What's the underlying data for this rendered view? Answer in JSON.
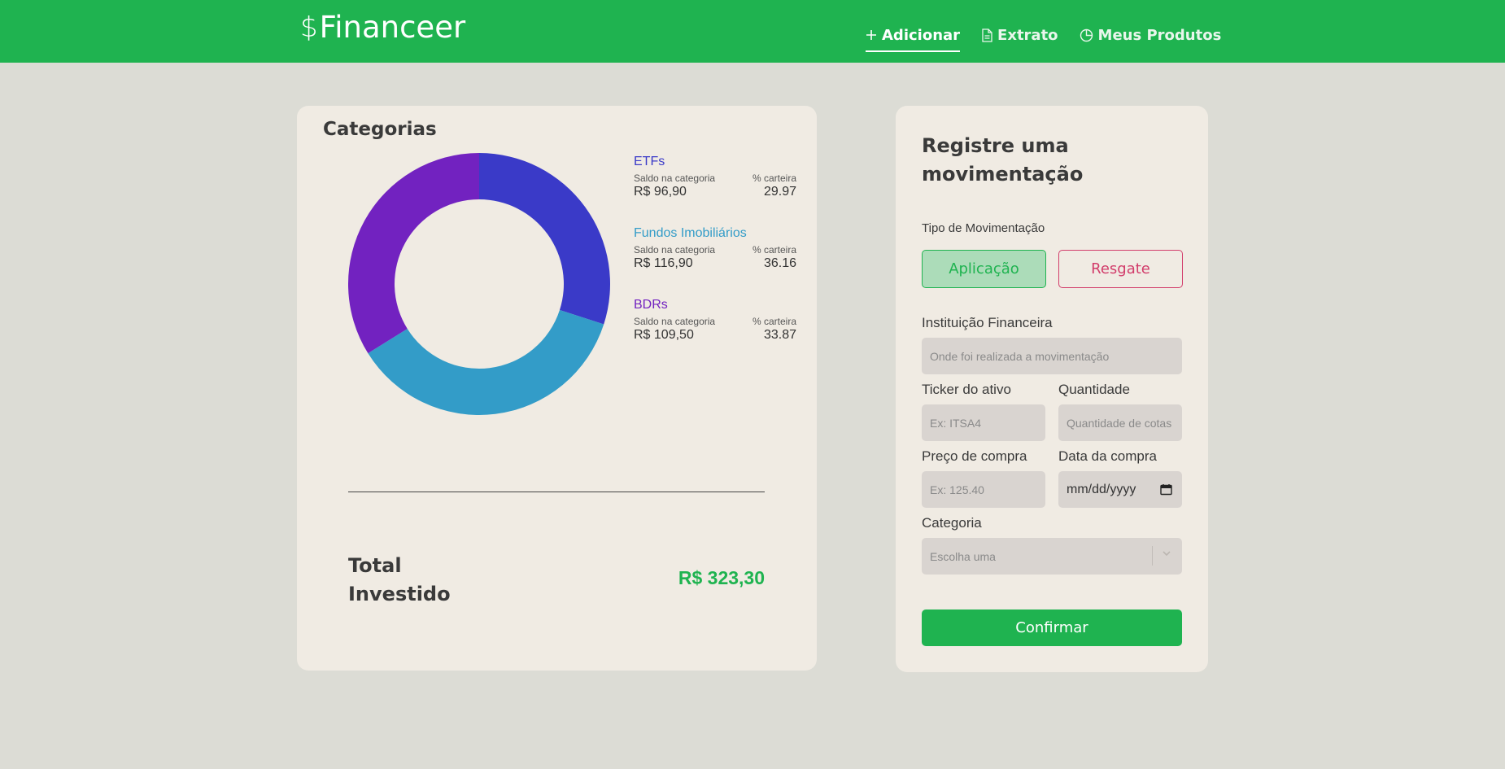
{
  "header": {
    "logo_symbol": "$",
    "logo_text": "Financeer",
    "nav": [
      {
        "label": "Adicionar",
        "icon": "plus-icon",
        "active": true
      },
      {
        "label": "Extrato",
        "icon": "document-icon",
        "active": false
      },
      {
        "label": "Meus Produtos",
        "icon": "pie-chart-icon",
        "active": false
      }
    ]
  },
  "categories_card": {
    "title": "Categorias",
    "items": [
      {
        "name": "ETFs",
        "saldo_label": "Saldo na categoria",
        "pct_label": "% carteira",
        "saldo": "R$ 96,90",
        "pct": "29.97",
        "color": "#3a3ac8"
      },
      {
        "name": "Fundos Imobiliários",
        "saldo_label": "Saldo na categoria",
        "pct_label": "% carteira",
        "saldo": "R$ 116,90",
        "pct": "36.16",
        "color": "#339cc8"
      },
      {
        "name": "BDRs",
        "saldo_label": "Saldo na categoria",
        "pct_label": "% carteira",
        "saldo": "R$ 109,50",
        "pct": "33.87",
        "color": "#7222c0"
      }
    ],
    "total_label": "Total Investido",
    "total_value": "R$ 323,30"
  },
  "chart_data": {
    "type": "pie",
    "categories": [
      "ETFs",
      "Fundos Imobiliários",
      "BDRs"
    ],
    "values": [
      29.97,
      36.16,
      33.87
    ],
    "colors": [
      "#3a3ac8",
      "#339cc8",
      "#7222c0"
    ]
  },
  "form": {
    "title": "Registre uma movimentação",
    "tipo_label": "Tipo de Movimentação",
    "aplicacao_label": "Aplicação",
    "resgate_label": "Resgate",
    "instituicao_label": "Instituição Financeira",
    "instituicao_placeholder": "Onde foi realizada a movimentação",
    "ticker_label": "Ticker do ativo",
    "ticker_placeholder": "Ex: ITSA4",
    "quantidade_label": "Quantidade",
    "quantidade_placeholder": "Quantidade de cotas",
    "preco_label": "Preço de compra",
    "preco_placeholder": "Ex: 125.40",
    "data_label": "Data da compra",
    "data_value": "mm/dd/yyyy",
    "categoria_label": "Categoria",
    "categoria_placeholder": "Escolha uma",
    "confirm_label": "Confirmar"
  }
}
